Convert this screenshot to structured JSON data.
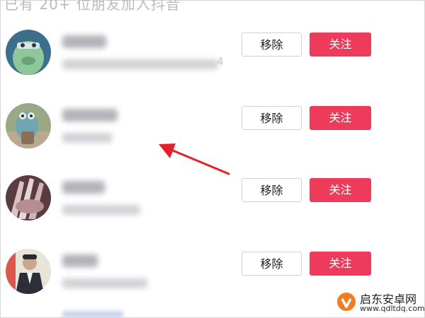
{
  "header": {
    "text": "已有 20+ 位朋友加入抖音"
  },
  "rows": [
    {
      "name_blurred": true,
      "sub_tail": "4",
      "remove_label": "移除",
      "follow_label": "关注"
    },
    {
      "name_blurred": true,
      "sub_tail": "",
      "remove_label": "移除",
      "follow_label": "关注"
    },
    {
      "name_blurred": true,
      "sub_tail": "",
      "remove_label": "移除",
      "follow_label": "关注"
    },
    {
      "name_blurred": true,
      "sub_tail": "",
      "remove_label": "移除",
      "follow_label": "关注"
    }
  ],
  "annotation": {
    "arrow_color": "#e3212a"
  },
  "watermark": {
    "title": "启东安卓网",
    "url": "www.qdltdq.com",
    "logo_color": "#f07d24"
  },
  "colors": {
    "follow_button": "#ef3b5b",
    "remove_border": "#cfcfd4"
  }
}
